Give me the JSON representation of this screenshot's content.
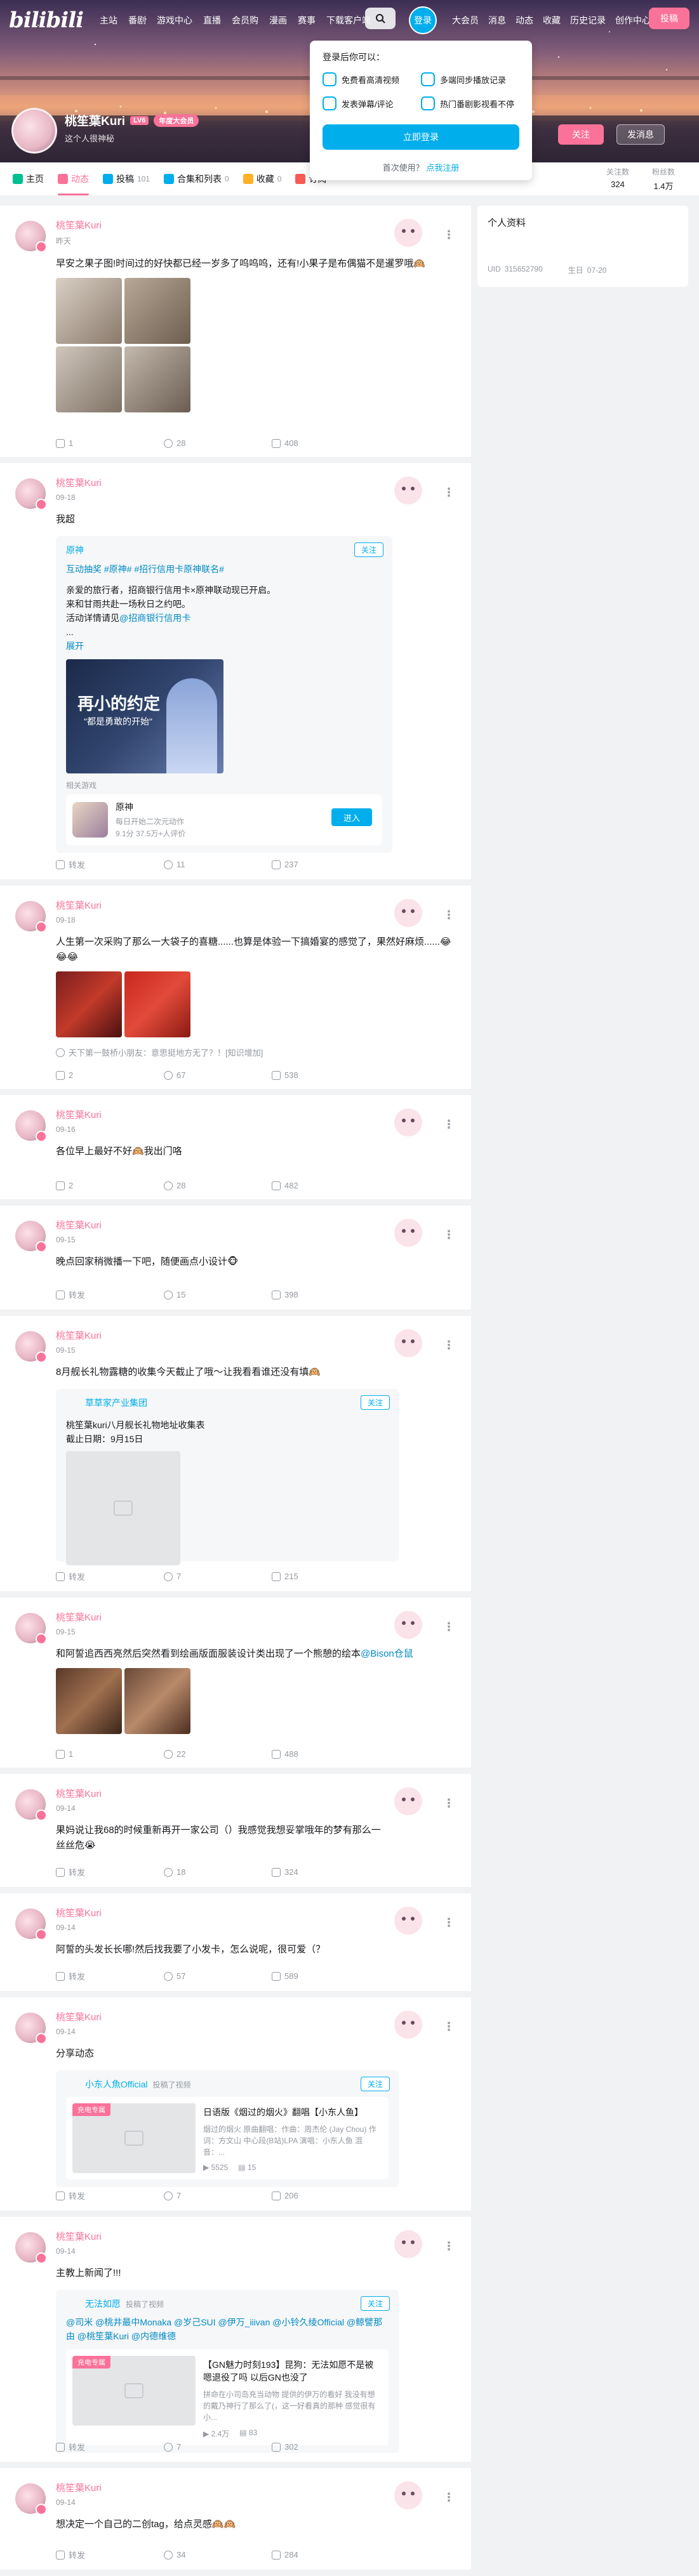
{
  "header": {
    "logo": "bilibili",
    "nav": [
      "主站",
      "番剧",
      "游戏中心",
      "直播",
      "会员购",
      "漫画",
      "赛事",
      "下载客户端"
    ],
    "login": "登录",
    "right_nav": [
      "大会员",
      "消息",
      "动态",
      "收藏",
      "历史记录",
      "创作中心"
    ],
    "post": "投稿"
  },
  "login_popup": {
    "title": "登录后你可以：",
    "benefits": [
      "免费看高清视频",
      "多端同步播放记录",
      "发表弹幕/评论",
      "热门番剧影视看不停"
    ],
    "button": "立即登录",
    "footer_text": "首次使用？",
    "footer_link": "点我注册"
  },
  "profile": {
    "name": "桃笙葉Kuri",
    "level": "LV6",
    "vip": "年度大会员",
    "signature": "这个人很神秘",
    "follow": "关注",
    "message": "发消息"
  },
  "tabs": [
    {
      "label": "主页",
      "count": ""
    },
    {
      "label": "动态",
      "count": ""
    },
    {
      "label": "投稿",
      "count": "101"
    },
    {
      "label": "合集和列表",
      "count": "0"
    },
    {
      "label": "收藏",
      "count": "0"
    },
    {
      "label": "订阅",
      "count": ""
    }
  ],
  "stats": [
    {
      "label": "关注数",
      "value": "324"
    },
    {
      "label": "粉丝数",
      "value": "1.4万"
    }
  ],
  "sidebar": {
    "title": "个人资料",
    "uid_label": "UID",
    "uid": "315652790",
    "birthday_label": "生日",
    "birthday": "07-20"
  },
  "posts": [
    {
      "author": "桃笙葉Kuri",
      "date": "昨天",
      "text": "早安之果子图!时间过的好快都已经一岁多了呜呜呜，还有!小果子是布偶猫不是暹罗哦🙉",
      "forward": "1",
      "comment": "28",
      "like": "408"
    },
    {
      "author": "桃笙葉Kuri",
      "date": "09-18",
      "text": "我超",
      "forward": "转发",
      "comment": "11",
      "like": "237",
      "fwd": {
        "author": "原神",
        "follow": "关注",
        "tag_line": "互动抽奖 #原神# #招行信用卡原神联名#",
        "body1": "亲爱的旅行者，招商银行信用卡×原神联动现已开启。",
        "body2": "来和甘雨共赴一场秋日之约吧。",
        "body3_prefix": "活动详情请见",
        "body3_link": "@招商银行信用卡",
        "ellipsis": "...",
        "expand": "展开",
        "poster_title": "再小的约定",
        "poster_sub": "\"都是勇敢的开始\"",
        "related": "相关游戏",
        "game_name": "原神",
        "game_desc": "每日开始二次元动作",
        "game_rating": "9.1分 37.5万+人评价",
        "game_btn": "进入"
      }
    },
    {
      "author": "桃笙葉Kuri",
      "date": "09-18",
      "text": "人生第一次采购了那么一大袋子的喜糖......也算是体验一下搞婚宴的感觉了，果然好麻烦......😂😂😂",
      "comment_preview": "天下第一鼓桥小朋友：意思挺地方无了？！[知识增加]",
      "forward": "2",
      "comment": "67",
      "like": "538"
    },
    {
      "author": "桃笙葉Kuri",
      "date": "09-16",
      "text": "各位早上最好不好🙉我出门咯",
      "forward": "2",
      "comment": "28",
      "like": "482"
    },
    {
      "author": "桃笙葉Kuri",
      "date": "09-15",
      "text": "晚点回家稍微播一下吧，随便画点小设计🐵",
      "forward": "转发",
      "comment": "15",
      "like": "398"
    },
    {
      "author": "桃笙葉Kuri",
      "date": "09-15",
      "text": "8月舰长礼物露糖的收集今天截止了哦～让我看看谁还没有填🙉",
      "forward": "转发",
      "comment": "7",
      "like": "215",
      "fwd": {
        "author": "草草家产业集团",
        "follow": "关注",
        "line1": "桃笙葉kuri八月舰长礼物地址收集表",
        "line2": "截止日期：9月15日"
      }
    },
    {
      "author": "桃笙葉Kuri",
      "date": "09-15",
      "text": "和阿誓追西西亮然后突然看到绘画版面服装设计类出现了一个熊憩的绘本",
      "text_link": "@Bison仓鼠",
      "forward": "1",
      "comment": "22",
      "like": "488"
    },
    {
      "author": "桃笙葉Kuri",
      "date": "09-14",
      "text": "果妈说让我68的时候重新再开一家公司（）我感觉我想妥掌哦年的梦有那么一丝丝危😭",
      "forward": "转发",
      "comment": "18",
      "like": "324"
    },
    {
      "author": "桃笙葉Kuri",
      "date": "09-14",
      "text": "阿誓的头发长长哪!然后找我要了小发卡，怎么说呢，很可爱（？",
      "forward": "转发",
      "comment": "57",
      "like": "589"
    },
    {
      "author": "桃笙葉Kuri",
      "date": "09-14",
      "text": "分享动态",
      "forward": "转发",
      "comment": "7",
      "like": "206",
      "fwd": {
        "author": "小东人魚Official",
        "action": "投稿了视频",
        "follow": "关注",
        "badge": "充电专属",
        "video_title": "日语版《烟过的烟火》翻唱【小东人鱼】",
        "video_desc": "烟过的烟火 原曲翻唱：作曲：周杰伦 (Jay Chou) 作词：方文山 中心段(B站)LPA 演唱：小东人鱼 混音：...",
        "views": "5525",
        "danmaku": "15"
      }
    },
    {
      "author": "桃笙葉Kuri",
      "date": "09-14",
      "text": "主教上新闻了!!!",
      "forward": "转发",
      "comment": "7",
      "like": "302",
      "fwd": {
        "author": "无法如愿",
        "action": "投稿了视频",
        "follow": "关注",
        "mentions": "@司米 @桃井最中Monaka @岁己SUI @伊万_iiivan @小铃久绫Official @鲸譬那由 @桃笙葉Kuri @内德维德",
        "badge": "充电专属",
        "video_title": "【GN魅力时刻193】昆狗：无法如愿不是被嗯退役了吗 以后GN也没了",
        "video_desc": "拼命在小司岛充当动物 提供的伊万的看好 我没有想的戴乃神行了那么了(，这一好看真的那种 感觉很有小...",
        "views": "2.4万",
        "danmaku": "83"
      }
    },
    {
      "author": "桃笙葉Kuri",
      "date": "09-14",
      "text": "想决定一个自己的二创tag，给点灵感🙉🙉",
      "forward": "转发",
      "comment": "34",
      "like": "284"
    }
  ],
  "colors": {
    "brand_pink": "#fb7299",
    "brand_blue": "#00aeec",
    "text": "#18191c",
    "muted": "#9499a0"
  }
}
